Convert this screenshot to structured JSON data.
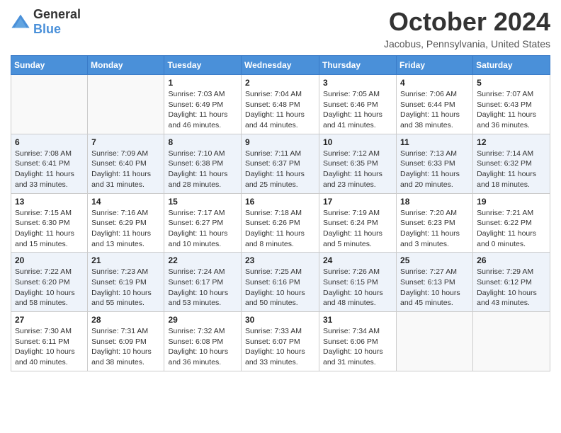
{
  "header": {
    "logo": {
      "general": "General",
      "blue": "Blue"
    },
    "title": "October 2024",
    "location": "Jacobus, Pennsylvania, United States"
  },
  "weekdays": [
    "Sunday",
    "Monday",
    "Tuesday",
    "Wednesday",
    "Thursday",
    "Friday",
    "Saturday"
  ],
  "weeks": [
    [
      {
        "day": "",
        "sunrise": "",
        "sunset": "",
        "daylight": ""
      },
      {
        "day": "",
        "sunrise": "",
        "sunset": "",
        "daylight": ""
      },
      {
        "day": "1",
        "sunrise": "Sunrise: 7:03 AM",
        "sunset": "Sunset: 6:49 PM",
        "daylight": "Daylight: 11 hours and 46 minutes."
      },
      {
        "day": "2",
        "sunrise": "Sunrise: 7:04 AM",
        "sunset": "Sunset: 6:48 PM",
        "daylight": "Daylight: 11 hours and 44 minutes."
      },
      {
        "day": "3",
        "sunrise": "Sunrise: 7:05 AM",
        "sunset": "Sunset: 6:46 PM",
        "daylight": "Daylight: 11 hours and 41 minutes."
      },
      {
        "day": "4",
        "sunrise": "Sunrise: 7:06 AM",
        "sunset": "Sunset: 6:44 PM",
        "daylight": "Daylight: 11 hours and 38 minutes."
      },
      {
        "day": "5",
        "sunrise": "Sunrise: 7:07 AM",
        "sunset": "Sunset: 6:43 PM",
        "daylight": "Daylight: 11 hours and 36 minutes."
      }
    ],
    [
      {
        "day": "6",
        "sunrise": "Sunrise: 7:08 AM",
        "sunset": "Sunset: 6:41 PM",
        "daylight": "Daylight: 11 hours and 33 minutes."
      },
      {
        "day": "7",
        "sunrise": "Sunrise: 7:09 AM",
        "sunset": "Sunset: 6:40 PM",
        "daylight": "Daylight: 11 hours and 31 minutes."
      },
      {
        "day": "8",
        "sunrise": "Sunrise: 7:10 AM",
        "sunset": "Sunset: 6:38 PM",
        "daylight": "Daylight: 11 hours and 28 minutes."
      },
      {
        "day": "9",
        "sunrise": "Sunrise: 7:11 AM",
        "sunset": "Sunset: 6:37 PM",
        "daylight": "Daylight: 11 hours and 25 minutes."
      },
      {
        "day": "10",
        "sunrise": "Sunrise: 7:12 AM",
        "sunset": "Sunset: 6:35 PM",
        "daylight": "Daylight: 11 hours and 23 minutes."
      },
      {
        "day": "11",
        "sunrise": "Sunrise: 7:13 AM",
        "sunset": "Sunset: 6:33 PM",
        "daylight": "Daylight: 11 hours and 20 minutes."
      },
      {
        "day": "12",
        "sunrise": "Sunrise: 7:14 AM",
        "sunset": "Sunset: 6:32 PM",
        "daylight": "Daylight: 11 hours and 18 minutes."
      }
    ],
    [
      {
        "day": "13",
        "sunrise": "Sunrise: 7:15 AM",
        "sunset": "Sunset: 6:30 PM",
        "daylight": "Daylight: 11 hours and 15 minutes."
      },
      {
        "day": "14",
        "sunrise": "Sunrise: 7:16 AM",
        "sunset": "Sunset: 6:29 PM",
        "daylight": "Daylight: 11 hours and 13 minutes."
      },
      {
        "day": "15",
        "sunrise": "Sunrise: 7:17 AM",
        "sunset": "Sunset: 6:27 PM",
        "daylight": "Daylight: 11 hours and 10 minutes."
      },
      {
        "day": "16",
        "sunrise": "Sunrise: 7:18 AM",
        "sunset": "Sunset: 6:26 PM",
        "daylight": "Daylight: 11 hours and 8 minutes."
      },
      {
        "day": "17",
        "sunrise": "Sunrise: 7:19 AM",
        "sunset": "Sunset: 6:24 PM",
        "daylight": "Daylight: 11 hours and 5 minutes."
      },
      {
        "day": "18",
        "sunrise": "Sunrise: 7:20 AM",
        "sunset": "Sunset: 6:23 PM",
        "daylight": "Daylight: 11 hours and 3 minutes."
      },
      {
        "day": "19",
        "sunrise": "Sunrise: 7:21 AM",
        "sunset": "Sunset: 6:22 PM",
        "daylight": "Daylight: 11 hours and 0 minutes."
      }
    ],
    [
      {
        "day": "20",
        "sunrise": "Sunrise: 7:22 AM",
        "sunset": "Sunset: 6:20 PM",
        "daylight": "Daylight: 10 hours and 58 minutes."
      },
      {
        "day": "21",
        "sunrise": "Sunrise: 7:23 AM",
        "sunset": "Sunset: 6:19 PM",
        "daylight": "Daylight: 10 hours and 55 minutes."
      },
      {
        "day": "22",
        "sunrise": "Sunrise: 7:24 AM",
        "sunset": "Sunset: 6:17 PM",
        "daylight": "Daylight: 10 hours and 53 minutes."
      },
      {
        "day": "23",
        "sunrise": "Sunrise: 7:25 AM",
        "sunset": "Sunset: 6:16 PM",
        "daylight": "Daylight: 10 hours and 50 minutes."
      },
      {
        "day": "24",
        "sunrise": "Sunrise: 7:26 AM",
        "sunset": "Sunset: 6:15 PM",
        "daylight": "Daylight: 10 hours and 48 minutes."
      },
      {
        "day": "25",
        "sunrise": "Sunrise: 7:27 AM",
        "sunset": "Sunset: 6:13 PM",
        "daylight": "Daylight: 10 hours and 45 minutes."
      },
      {
        "day": "26",
        "sunrise": "Sunrise: 7:29 AM",
        "sunset": "Sunset: 6:12 PM",
        "daylight": "Daylight: 10 hours and 43 minutes."
      }
    ],
    [
      {
        "day": "27",
        "sunrise": "Sunrise: 7:30 AM",
        "sunset": "Sunset: 6:11 PM",
        "daylight": "Daylight: 10 hours and 40 minutes."
      },
      {
        "day": "28",
        "sunrise": "Sunrise: 7:31 AM",
        "sunset": "Sunset: 6:09 PM",
        "daylight": "Daylight: 10 hours and 38 minutes."
      },
      {
        "day": "29",
        "sunrise": "Sunrise: 7:32 AM",
        "sunset": "Sunset: 6:08 PM",
        "daylight": "Daylight: 10 hours and 36 minutes."
      },
      {
        "day": "30",
        "sunrise": "Sunrise: 7:33 AM",
        "sunset": "Sunset: 6:07 PM",
        "daylight": "Daylight: 10 hours and 33 minutes."
      },
      {
        "day": "31",
        "sunrise": "Sunrise: 7:34 AM",
        "sunset": "Sunset: 6:06 PM",
        "daylight": "Daylight: 10 hours and 31 minutes."
      },
      {
        "day": "",
        "sunrise": "",
        "sunset": "",
        "daylight": ""
      },
      {
        "day": "",
        "sunrise": "",
        "sunset": "",
        "daylight": ""
      }
    ]
  ]
}
